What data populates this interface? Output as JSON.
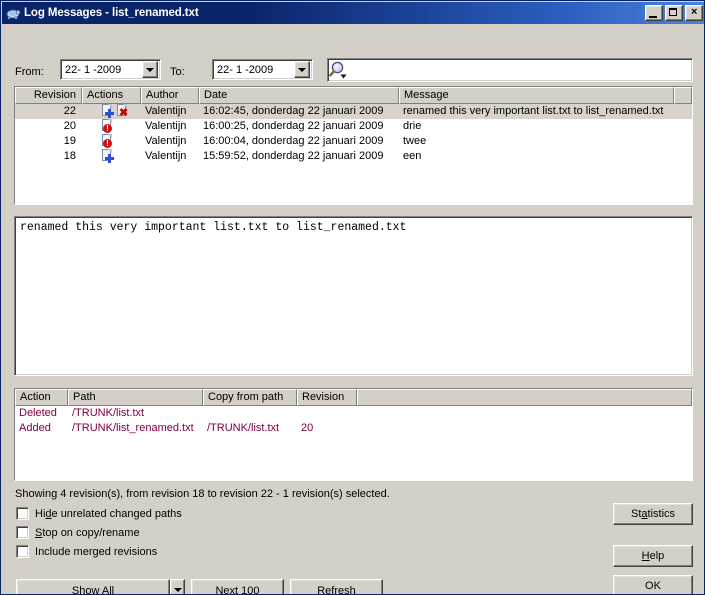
{
  "window": {
    "title": "Log Messages - list_renamed.txt",
    "icon": "tortoise-icon",
    "minimize_label": "",
    "maximize_label": "",
    "close_label": "×"
  },
  "filter": {
    "from_label": "From:",
    "from_value": "22- 1 -2009",
    "to_label": "To:",
    "to_value": "22- 1 -2009",
    "search_value": "",
    "search_placeholder": ""
  },
  "revisions_table": {
    "columns": [
      "Revision",
      "Actions",
      "Author",
      "Date",
      "Message"
    ],
    "rows": [
      {
        "revision": "22",
        "actions": [
          "added",
          "deleted"
        ],
        "author": "Valentijn",
        "date": "16:02:45, donderdag 22 januari 2009",
        "message": "renamed this very important list.txt to list_renamed.txt",
        "selected": true
      },
      {
        "revision": "20",
        "actions": [
          "modified"
        ],
        "author": "Valentijn",
        "date": "16:00:25, donderdag 22 januari 2009",
        "message": "drie",
        "selected": false
      },
      {
        "revision": "19",
        "actions": [
          "modified"
        ],
        "author": "Valentijn",
        "date": "16:00:04, donderdag 22 januari 2009",
        "message": "twee",
        "selected": false
      },
      {
        "revision": "18",
        "actions": [
          "added"
        ],
        "author": "Valentijn",
        "date": "15:59:52, donderdag 22 januari 2009",
        "message": "een",
        "selected": false
      }
    ]
  },
  "message_box": {
    "text": "renamed this very important list.txt to list_renamed.txt"
  },
  "paths_table": {
    "columns": [
      "Action",
      "Path",
      "Copy from path",
      "Revision"
    ],
    "rows": [
      {
        "action": "Deleted",
        "path": "/TRUNK/list.txt",
        "copy_from_path": "",
        "revision": ""
      },
      {
        "action": "Added",
        "path": "/TRUNK/list_renamed.txt",
        "copy_from_path": "/TRUNK/list.txt",
        "revision": "20"
      }
    ]
  },
  "status": {
    "text": "Showing 4 revision(s), from revision 18 to revision 22 - 1 revision(s) selected."
  },
  "options": {
    "hide_unrelated": {
      "label_pre": "Hi",
      "label_key": "d",
      "label_post": "e unrelated changed paths",
      "checked": false
    },
    "stop_on_copy": {
      "label_pre": "",
      "label_key": "S",
      "label_post": "top on copy/rename",
      "checked": false
    },
    "include_merged": {
      "label_pre": "",
      "label_key": "I",
      "label_post": "nclude merged revisions",
      "checked": false
    }
  },
  "buttons": {
    "statistics_pre": "St",
    "statistics_key": "a",
    "statistics_post": "tistics",
    "help_key": "H",
    "help_post": "elp",
    "ok": "OK",
    "show_all_pre": "Show ",
    "show_all_key": "A",
    "show_all_post": "ll",
    "next100_key": "N",
    "next100_post": "ext 100",
    "refresh": "Refresh"
  },
  "colors": {
    "titlebar_start": "#0a246a",
    "titlebar_end": "#4a82d8",
    "face": "#d4d0c8",
    "selection": "#d8d4cc",
    "path_text": "#800040",
    "added_badge": "#2a4fd0",
    "deleted_badge": "#cc0000",
    "modified_badge": "#cc1111"
  }
}
